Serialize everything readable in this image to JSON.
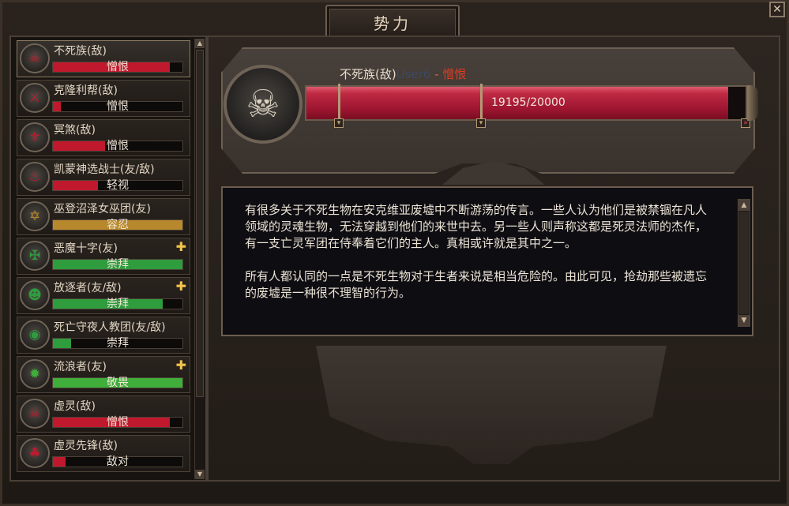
{
  "window": {
    "title": "势力",
    "close_glyph": "✕"
  },
  "factions": [
    {
      "name": "不死族(敌)",
      "status": "憎恨",
      "fill_pct": 90,
      "fill_color": "#c0192d",
      "icon": "skull-icon",
      "glyph": "☠",
      "plus": false,
      "selected": true
    },
    {
      "name": "克隆利帮(敌)",
      "status": "憎恨",
      "fill_pct": 6,
      "fill_color": "#c0192d",
      "icon": "crossed-guns-icon",
      "glyph": "⚔",
      "plus": false
    },
    {
      "name": "冥煞(敌)",
      "status": "憎恨",
      "fill_pct": 40,
      "fill_color": "#c0192d",
      "icon": "demon-sigil-icon",
      "glyph": "⚜",
      "plus": false
    },
    {
      "name": "凯蒙神选战士(友/敌)",
      "status": "轻视",
      "fill_pct": 35,
      "fill_color": "#c0192d",
      "icon": "flame-icon",
      "glyph": "♨",
      "plus": false
    },
    {
      "name": "巫登沼泽女巫团(友)",
      "status": "容忍",
      "fill_pct": 100,
      "fill_color": "#b8892c",
      "icon": "pentagram-icon",
      "glyph": "✡",
      "plus": false
    },
    {
      "name": "恶魔十字(友)",
      "status": "崇拜",
      "fill_pct": 100,
      "fill_color": "#2f9c3e",
      "icon": "cross-shield-icon",
      "glyph": "✠",
      "plus": true
    },
    {
      "name": "放逐者(友/敌)",
      "status": "崇拜",
      "fill_pct": 85,
      "fill_color": "#2f9c3e",
      "icon": "exile-mask-icon",
      "glyph": "☻",
      "plus": true
    },
    {
      "name": "死亡守夜人教团(友/敌)",
      "status": "崇拜",
      "fill_pct": 14,
      "fill_color": "#2f9c3e",
      "icon": "eye-icon",
      "glyph": "◉",
      "plus": false
    },
    {
      "name": "流浪者(友)",
      "status": "敬畏",
      "fill_pct": 100,
      "fill_color": "#3fae3a",
      "icon": "sun-icon",
      "glyph": "✹",
      "plus": true
    },
    {
      "name": "虚灵(敌)",
      "status": "憎恨",
      "fill_pct": 90,
      "fill_color": "#c0192d",
      "icon": "aether-skull-icon",
      "glyph": "☠",
      "plus": false
    },
    {
      "name": "虚灵先锋(敌)",
      "status": "敌对",
      "fill_pct": 10,
      "fill_color": "#c0192d",
      "icon": "aether-vanguard-icon",
      "glyph": "♣",
      "plus": false
    }
  ],
  "plus_glyph": "✚",
  "selected": {
    "name": "不死族(敌)",
    "user": "User6",
    "dash": " - ",
    "status": "憎恨",
    "progress_text": "19195/20000",
    "progress_fraction": 0.96
  },
  "description": {
    "p1": "有很多关于不死生物在安克维亚废墟中不断游荡的传言。一些人认为他们是被禁锢在凡人领域的灵魂生物，无法穿越到他们的来世中去。另一些人则声称这都是死灵法师的杰作，有一支亡灵军团在侍奉着它们的主人。真相或许就是其中之一。",
    "p2": "所有人都认同的一点是不死生物对于生者来说是相当危险的。由此可见，抢劫那些被遗忘的废墟是一种很不理智的行为。"
  },
  "scroll": {
    "up": "▲",
    "down": "▼"
  }
}
